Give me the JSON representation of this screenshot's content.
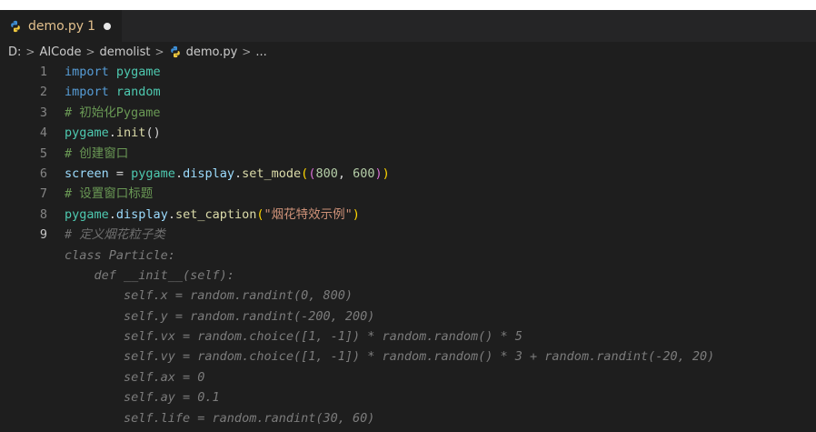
{
  "tab": {
    "filename": "demo.py",
    "problems": "1",
    "icon": "python-icon"
  },
  "breadcrumb": {
    "items": [
      "D:",
      "AICode",
      "demolist",
      "demo.py",
      "..."
    ],
    "separator": ">"
  },
  "lines": [
    {
      "n": "1",
      "t": [
        [
          "import",
          "kw"
        ],
        [
          " ",
          ""
        ],
        [
          "pygame",
          "mod"
        ]
      ]
    },
    {
      "n": "2",
      "t": [
        [
          "import",
          "kw"
        ],
        [
          " ",
          ""
        ],
        [
          "random",
          "mod"
        ]
      ]
    },
    {
      "n": "3",
      "t": [
        [
          "# 初始化Pygame",
          "cm"
        ]
      ]
    },
    {
      "n": "4",
      "t": [
        [
          "pygame",
          "mod"
        ],
        [
          ".",
          ""
        ],
        [
          "init",
          "fn"
        ],
        [
          "()",
          ""
        ]
      ]
    },
    {
      "n": "5",
      "t": [
        [
          "# 创建窗口",
          "cm"
        ]
      ]
    },
    {
      "n": "6",
      "t": [
        [
          "screen",
          "var"
        ],
        [
          " = ",
          ""
        ],
        [
          "pygame",
          "mod"
        ],
        [
          ".",
          ""
        ],
        [
          "display",
          "var"
        ],
        [
          ".",
          ""
        ],
        [
          "set_mode",
          "fn"
        ],
        [
          "(",
          "paren2"
        ],
        [
          "(",
          "paren1"
        ],
        [
          "800",
          "num"
        ],
        [
          ", ",
          ""
        ],
        [
          "600",
          "num"
        ],
        [
          ")",
          "paren1"
        ],
        [
          ")",
          "paren2"
        ]
      ]
    },
    {
      "n": "7",
      "t": [
        [
          "# 设置窗口标题",
          "cm"
        ]
      ]
    },
    {
      "n": "8",
      "t": [
        [
          "pygame",
          "mod"
        ],
        [
          ".",
          ""
        ],
        [
          "display",
          "var"
        ],
        [
          ".",
          ""
        ],
        [
          "set_caption",
          "fn"
        ],
        [
          "(",
          "paren2"
        ],
        [
          "\"烟花特效示例\"",
          "str"
        ],
        [
          ")",
          "paren2"
        ]
      ]
    },
    {
      "n": "9",
      "t": [
        [
          "# 定义烟花粒子类",
          "ghost cm2"
        ]
      ],
      "current": true
    },
    {
      "n": "",
      "t": [
        [
          "class Particle:",
          "ghost"
        ]
      ]
    },
    {
      "n": "",
      "t": [
        [
          "    def __init__(self):",
          "ghost"
        ]
      ]
    },
    {
      "n": "",
      "t": [
        [
          "        self.x = random.randint(0, 800)",
          "ghost"
        ]
      ]
    },
    {
      "n": "",
      "t": [
        [
          "        self.y = random.randint(-200, 200)",
          "ghost"
        ]
      ]
    },
    {
      "n": "",
      "t": [
        [
          "        self.vx = random.choice([1, -1]) * random.random() * 5",
          "ghost"
        ]
      ]
    },
    {
      "n": "",
      "t": [
        [
          "        self.vy = random.choice([1, -1]) * random.random() * 3 + random.randint(-20, 20)",
          "ghost"
        ]
      ]
    },
    {
      "n": "",
      "t": [
        [
          "        self.ax = 0",
          "ghost"
        ]
      ]
    },
    {
      "n": "",
      "t": [
        [
          "        self.ay = 0.1",
          "ghost"
        ]
      ]
    },
    {
      "n": "",
      "t": [
        [
          "        self.life = random.randint(30, 60)",
          "ghost"
        ]
      ]
    }
  ],
  "colors": {
    "background": "#1e1e1e",
    "tab_modified_text": "#e2c08d",
    "keyword": "#569cd6",
    "module": "#4ec9b0",
    "function": "#dcdcaa",
    "string": "#ce9178",
    "comment": "#6a9955"
  }
}
